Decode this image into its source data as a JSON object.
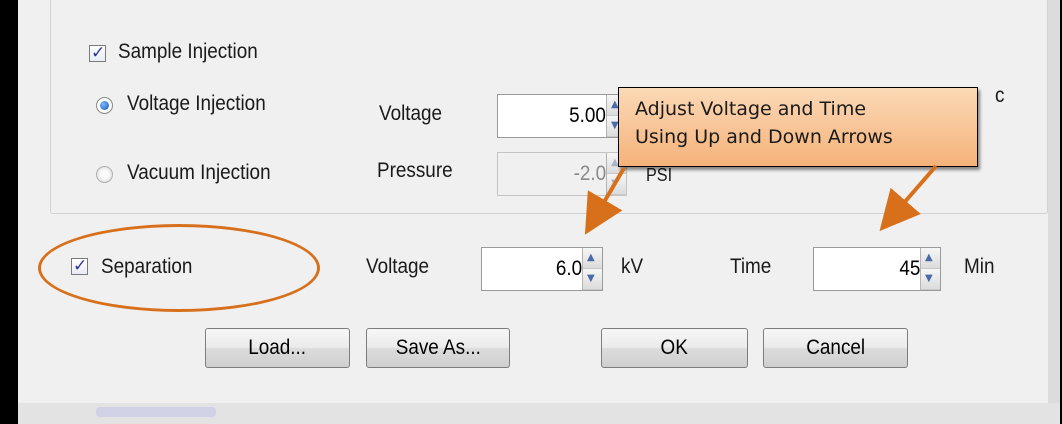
{
  "sample_injection": {
    "checkbox_label": "Sample Injection",
    "checked": true,
    "voltage_injection": {
      "radio_label": "Voltage Injection",
      "selected": true,
      "field_label": "Voltage",
      "value": "5.00",
      "unit_fragment": "c"
    },
    "vacuum_injection": {
      "radio_label": "Vacuum Injection",
      "selected": false,
      "field_label": "Pressure",
      "value": "-2.0",
      "unit": "PSI"
    }
  },
  "separation": {
    "checkbox_label": "Separation",
    "checked": true,
    "voltage_label": "Voltage",
    "voltage_value": "6.0",
    "voltage_unit": "kV",
    "time_label": "Time",
    "time_value": "45",
    "time_unit": "Min"
  },
  "buttons": {
    "load": "Load...",
    "save_as": "Save As...",
    "ok": "OK",
    "cancel": "Cancel"
  },
  "callout": {
    "line1": "Adjust Voltage and Time",
    "line2": "Using Up and Down Arrows"
  },
  "colors": {
    "annotation_orange": "#d8701b",
    "callout_fill": "#f5b27a",
    "radio_selected": "#1a57b8"
  }
}
